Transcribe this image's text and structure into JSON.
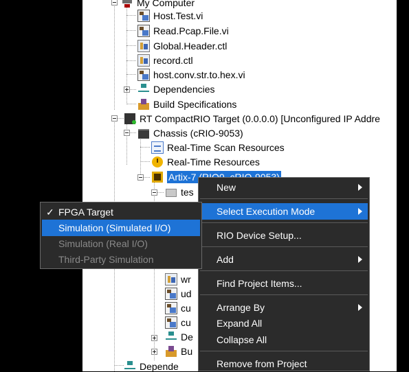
{
  "tree": {
    "my_computer": "My Computer",
    "host_test_vi": "Host.Test.vi",
    "read_pcap_vi": "Read.Pcap.File.vi",
    "global_header_ctl": "Global.Header.ctl",
    "record_ctl": "record.ctl",
    "host_conv_vi": "host.conv.str.to.hex.vi",
    "dependencies": "Dependencies",
    "build_specs": "Build Specifications",
    "rt_target": "RT CompactRIO Target (0.0.0.0) [Unconfigured IP Addre",
    "chassis": "Chassis (cRIO-9053)",
    "scan_resources": "Real-Time Scan Resources",
    "rt_resources": "Real-Time Resources",
    "fpga_target": "Artix-7 (RIO0, cRIO-9053)",
    "tes_folder": "tes",
    "wr": "wr",
    "ud": "ud",
    "cu1": "cu",
    "cu2": "cu",
    "de": "De",
    "bu": "Bu",
    "dependencies_bottom": "Depende"
  },
  "context_menu": {
    "new": "New",
    "select_execution_mode": "Select Execution Mode",
    "rio_device_setup": "RIO Device Setup...",
    "add": "Add",
    "find_project_items": "Find Project Items...",
    "arrange_by": "Arrange By",
    "expand_all": "Expand All",
    "collapse_all": "Collapse All",
    "remove_from_project": "Remove from Project"
  },
  "execution_submenu": {
    "checkmark": "✓",
    "fpga_target": "FPGA Target",
    "simulation_simulated_io": "Simulation (Simulated I/O)",
    "simulation_real_io": "Simulation (Real I/O)",
    "third_party_simulation": "Third-Party Simulation"
  },
  "colors": {
    "selection": "#1e73d6",
    "menu_background": "#2b2b2b"
  }
}
